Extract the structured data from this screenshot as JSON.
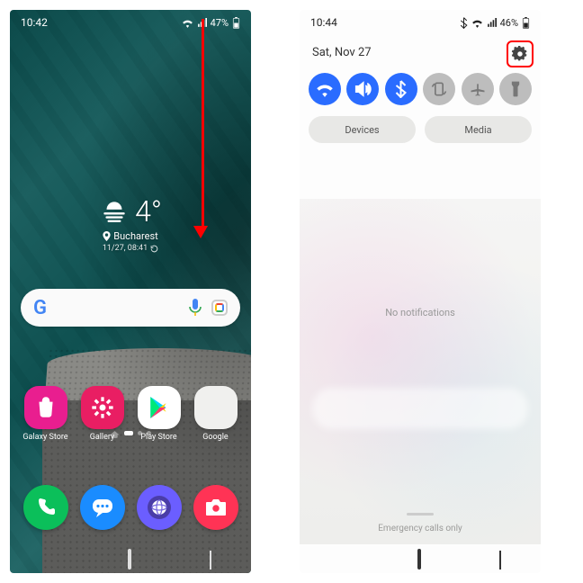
{
  "left": {
    "status": {
      "time": "10:42",
      "battery": "47%"
    },
    "weather": {
      "temp": "4°",
      "location": "Bucharest",
      "timestamp": "11/27, 08:41"
    },
    "apps_row1": [
      {
        "name": "galaxy-store",
        "label": "Galaxy Store"
      },
      {
        "name": "gallery",
        "label": "Gallery"
      },
      {
        "name": "play-store",
        "label": "Play Store"
      },
      {
        "name": "google-folder",
        "label": "Google"
      }
    ],
    "apps_row2": [
      {
        "name": "phone"
      },
      {
        "name": "messages"
      },
      {
        "name": "browser"
      },
      {
        "name": "camera"
      }
    ]
  },
  "right": {
    "status": {
      "time": "10:44",
      "battery": "46%"
    },
    "date": "Sat, Nov 27",
    "quick_toggles": [
      {
        "name": "wifi",
        "on": true
      },
      {
        "name": "sound",
        "on": true
      },
      {
        "name": "bluetooth",
        "on": true
      },
      {
        "name": "rotate",
        "on": false
      },
      {
        "name": "airplane",
        "on": false
      },
      {
        "name": "flashlight",
        "on": false
      }
    ],
    "pills": {
      "devices": "Devices",
      "media": "Media"
    },
    "no_notifications": "No notifications",
    "emergency": "Emergency calls only"
  }
}
